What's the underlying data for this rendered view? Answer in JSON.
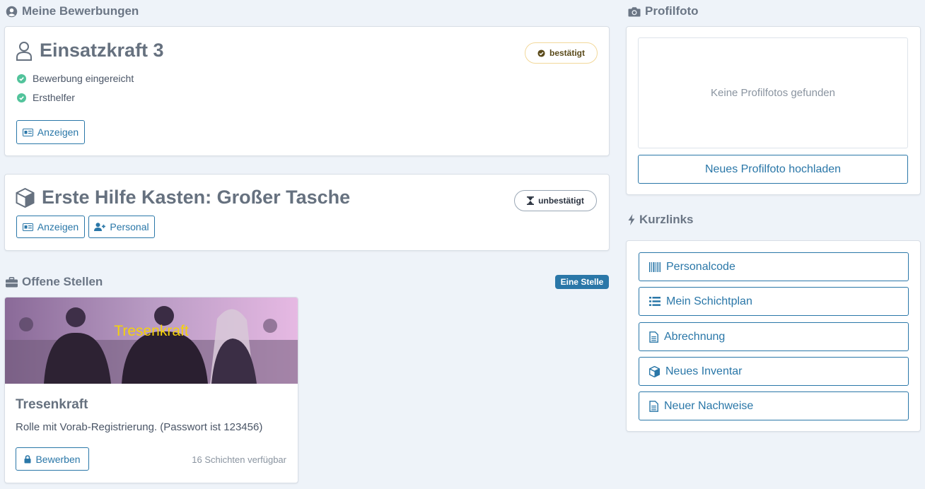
{
  "sections": {
    "applications_title": "Meine Bewerbungen",
    "open_positions_title": "Offene Stellen",
    "open_positions_badge": "Eine Stelle",
    "profile_photo_title": "Profilfoto",
    "quicklinks_title": "Kurzlinks"
  },
  "application1": {
    "title": "Einsatzkraft 3",
    "status": "bestätigt",
    "checks": [
      "Bewerbung eingereicht",
      "Ersthelfer"
    ],
    "show_label": "Anzeigen"
  },
  "application2": {
    "title": "Erste Hilfe Kasten: Großer Tasche",
    "status": "unbestätigt",
    "show_label": "Anzeigen",
    "staff_label": "Personal"
  },
  "position": {
    "banner_text": "Tresenkraft",
    "title": "Tresenkraft",
    "description": "Rolle mit Vorab-Registrierung. (Passwort ist 123456)",
    "apply_label": "Bewerben",
    "shifts_text": "16 Schichten verfügbar"
  },
  "profile": {
    "empty_text": "Keine Profilfotos gefunden",
    "upload_label": "Neues Profilfoto hochladen"
  },
  "quicklinks": [
    {
      "label": "Personalcode",
      "icon": "barcode-icon"
    },
    {
      "label": "Mein Schichtplan",
      "icon": "list-icon"
    },
    {
      "label": "Abrechnung",
      "icon": "document-icon"
    },
    {
      "label": "Neues Inventar",
      "icon": "cube-icon"
    },
    {
      "label": "Neuer Nachweise",
      "icon": "document-icon"
    }
  ],
  "colors": {
    "accent": "#2a77a8",
    "success": "#52c39b",
    "warning_border": "#f2d89a",
    "banner_text": "#f5d20a",
    "background": "#eef3f9"
  }
}
